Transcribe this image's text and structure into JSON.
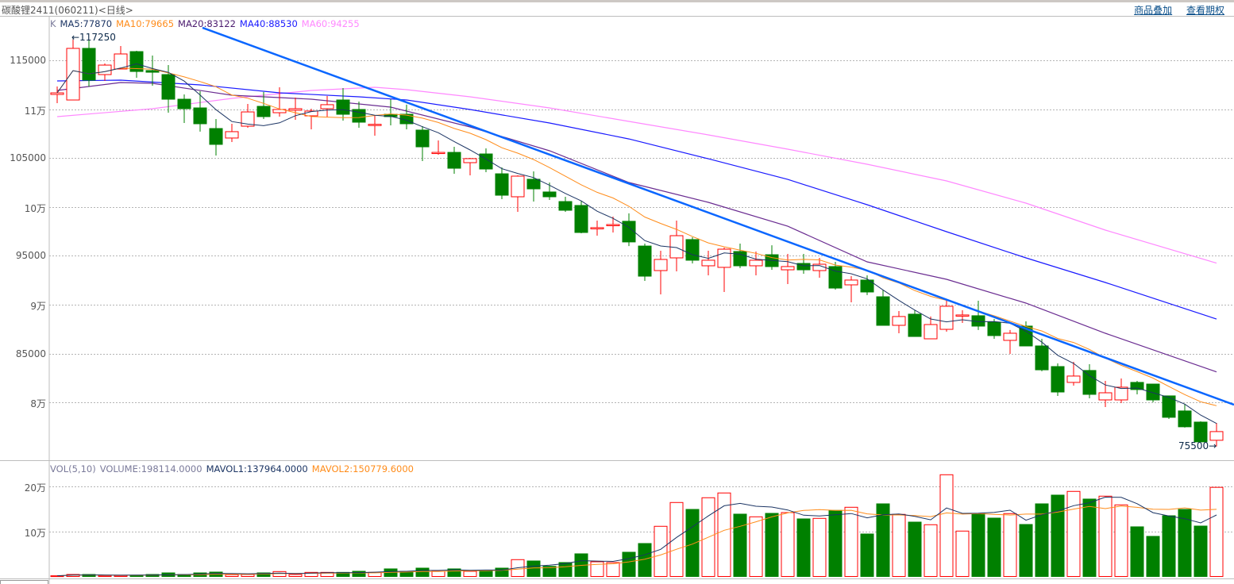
{
  "header": {
    "title": "碳酸锂2411(060211)<日线>",
    "links": [
      "商品叠加",
      "查看期权"
    ]
  },
  "legend": {
    "k": "K",
    "ma5": "MA5:77870",
    "ma10": "MA10:79665",
    "ma20": "MA20:83122",
    "ma40": "MA40:88530",
    "ma60": "MA60:94255"
  },
  "vol_legend": {
    "vol": "VOL(5,10)",
    "volume": "VOLUME:198114.0000",
    "mavol1": "MAVOL1:137964.0000",
    "mavol2": "MAVOL2:150779.6000"
  },
  "colors": {
    "up": "#ff0000",
    "down": "#008000",
    "ma5": "#1c3564",
    "ma10": "#ff8c1a",
    "ma20": "#6a2c91",
    "ma40": "#1a1aff",
    "ma60": "#ff88ff",
    "trend": "#0a66ff",
    "grid": "#b4b4b4"
  },
  "annotations": {
    "high": "←117250",
    "low": "75500→"
  },
  "chart_data": [
    {
      "type": "candlestick",
      "title": "碳酸锂2411 日线",
      "price_ticks": [
        {
          "value": 115000,
          "label": "115000"
        },
        {
          "value": 110000,
          "label": "11万"
        },
        {
          "value": 105000,
          "label": "105000"
        },
        {
          "value": 100000,
          "label": "10万"
        },
        {
          "value": 95000,
          "label": "95000"
        },
        {
          "value": 90000,
          "label": "9万"
        },
        {
          "value": 85000,
          "label": "85000"
        },
        {
          "value": 80000,
          "label": "8万"
        }
      ],
      "high_marker": {
        "index": 1,
        "value": 117250
      },
      "low_marker": {
        "index": 73,
        "value": 75500
      },
      "ohlc": [
        [
          111510,
          112320,
          110620,
          111670
        ],
        [
          110940,
          117250,
          110940,
          116220
        ],
        [
          116220,
          117100,
          112320,
          112970
        ],
        [
          113540,
          114680,
          112890,
          114510
        ],
        [
          114110,
          116460,
          114110,
          115650
        ],
        [
          115890,
          115970,
          113210,
          113860
        ],
        [
          113950,
          115490,
          112400,
          113780
        ],
        [
          113540,
          114510,
          109640,
          111020
        ],
        [
          111020,
          111510,
          108590,
          110050
        ],
        [
          110130,
          111840,
          107700,
          108510
        ],
        [
          108020,
          108990,
          105260,
          106400
        ],
        [
          107050,
          108510,
          106640,
          107700
        ],
        [
          108260,
          110540,
          108100,
          109720
        ],
        [
          110290,
          111760,
          108990,
          109240
        ],
        [
          109640,
          112240,
          109240,
          109970
        ],
        [
          109890,
          111190,
          108910,
          110050
        ],
        [
          109320,
          110050,
          107940,
          109810
        ],
        [
          110050,
          111350,
          109160,
          110460
        ],
        [
          110940,
          112160,
          108830,
          109480
        ],
        [
          109970,
          110780,
          108100,
          108670
        ],
        [
          108400,
          109320,
          107290,
          108450
        ],
        [
          109480,
          111020,
          108340,
          109240
        ],
        [
          109480,
          110460,
          107940,
          108510
        ],
        [
          107860,
          108260,
          104690,
          106150
        ],
        [
          105540,
          106800,
          105340,
          105580
        ],
        [
          105580,
          106150,
          103390,
          103960
        ],
        [
          104530,
          105020,
          103230,
          104940
        ],
        [
          105420,
          105990,
          103560,
          103880
        ],
        [
          103390,
          104040,
          100800,
          101200
        ],
        [
          101040,
          103230,
          99500,
          103150
        ],
        [
          102830,
          103640,
          100550,
          101850
        ],
        [
          101530,
          102500,
          100710,
          101040
        ],
        [
          100550,
          101040,
          99500,
          99660
        ],
        [
          100150,
          100630,
          97310,
          97390
        ],
        [
          97850,
          98600,
          97060,
          97880
        ],
        [
          98150,
          99010,
          97390,
          98200
        ],
        [
          98530,
          99340,
          96000,
          96420
        ],
        [
          96000,
          96250,
          92440,
          92920
        ],
        [
          93490,
          95520,
          91060,
          94630
        ],
        [
          94790,
          98600,
          93410,
          97060
        ],
        [
          96660,
          96900,
          94220,
          94550
        ],
        [
          93980,
          95520,
          93000,
          94550
        ],
        [
          93820,
          95840,
          91300,
          95680
        ],
        [
          95440,
          96250,
          93740,
          93980
        ],
        [
          93980,
          95440,
          93000,
          94550
        ],
        [
          95110,
          96080,
          93570,
          93900
        ],
        [
          93570,
          95190,
          92110,
          93900
        ],
        [
          94220,
          95190,
          93170,
          93570
        ],
        [
          93490,
          94790,
          92760,
          94140
        ],
        [
          93900,
          94380,
          91540,
          91700
        ],
        [
          92030,
          92920,
          90240,
          92520
        ],
        [
          92520,
          93000,
          90980,
          91300
        ],
        [
          90810,
          91540,
          87890,
          87890
        ],
        [
          87890,
          89350,
          87080,
          88790
        ],
        [
          89030,
          89430,
          86750,
          86750
        ],
        [
          86510,
          88790,
          86510,
          87970
        ],
        [
          87480,
          90490,
          87240,
          89840
        ],
        [
          88900,
          89430,
          88130,
          88950
        ],
        [
          88870,
          90410,
          87410,
          87810
        ],
        [
          88220,
          88540,
          86510,
          86840
        ],
        [
          86350,
          87410,
          84970,
          87080
        ],
        [
          87810,
          88300,
          85780,
          85780
        ],
        [
          85780,
          86510,
          83190,
          83340
        ],
        [
          83670,
          83990,
          80670,
          81070
        ],
        [
          82050,
          84160,
          81720,
          82700
        ],
        [
          83270,
          83910,
          80420,
          80830
        ],
        [
          80260,
          82210,
          79530,
          80990
        ],
        [
          80260,
          82450,
          79940,
          81560
        ],
        [
          82050,
          82210,
          80830,
          81320
        ],
        [
          81880,
          81880,
          80020,
          80260
        ],
        [
          80670,
          80670,
          78310,
          78480
        ],
        [
          79130,
          79860,
          77430,
          77510
        ],
        [
          77990,
          78070,
          75970,
          75970
        ],
        [
          76130,
          77910,
          75500,
          77020
        ]
      ],
      "moving_averages_knots": {
        "ma20": [
          [
            0,
            111915
          ],
          [
            4,
            112727
          ],
          [
            6,
            112650
          ],
          [
            11,
            111430
          ],
          [
            16,
            111023
          ],
          [
            21,
            110210
          ],
          [
            26,
            108180
          ],
          [
            31,
            105750
          ],
          [
            36,
            102500
          ],
          [
            41,
            100470
          ],
          [
            46,
            98030
          ],
          [
            51,
            94380
          ],
          [
            56,
            92600
          ],
          [
            61,
            90160
          ],
          [
            66,
            87080
          ],
          [
            73,
            83122
          ]
        ],
        "ma40": [
          [
            0,
            112890
          ],
          [
            4,
            112970
          ],
          [
            9,
            112480
          ],
          [
            14,
            111670
          ],
          [
            19,
            111270
          ],
          [
            22,
            110940
          ],
          [
            26,
            109970
          ],
          [
            31,
            108590
          ],
          [
            36,
            106960
          ],
          [
            41,
            104930
          ],
          [
            46,
            102820
          ],
          [
            51,
            100230
          ],
          [
            56,
            97470
          ],
          [
            61,
            94790
          ],
          [
            66,
            92270
          ],
          [
            73,
            88530
          ]
        ],
        "ma60": [
          [
            0,
            109236
          ],
          [
            6,
            110049
          ],
          [
            11,
            111104
          ],
          [
            16,
            111916
          ],
          [
            20,
            112240
          ],
          [
            22,
            111996
          ],
          [
            26,
            111265
          ],
          [
            31,
            110130
          ],
          [
            36,
            108750
          ],
          [
            41,
            107370
          ],
          [
            46,
            105910
          ],
          [
            51,
            104367
          ],
          [
            56,
            102664
          ],
          [
            61,
            100390
          ],
          [
            66,
            97630
          ],
          [
            73,
            94255
          ]
        ]
      },
      "trendline": {
        "from": [
          9.15,
          118330
        ],
        "to": [
          74.1,
          79770
        ]
      },
      "ylim": [
        74000,
        120000
      ]
    },
    {
      "type": "bar",
      "title": "VOL(5,10)",
      "volume_ticks": [
        {
          "value": 200000,
          "label": "20万"
        },
        {
          "value": 100000,
          "label": "10万"
        }
      ],
      "volume": [
        1500,
        4400,
        4400,
        2100,
        2100,
        2100,
        4400,
        7900,
        4400,
        7900,
        9700,
        3900,
        4400,
        7900,
        10900,
        4400,
        9100,
        9100,
        9100,
        11500,
        9100,
        16800,
        10900,
        18500,
        11500,
        16800,
        11500,
        12700,
        18500,
        37400,
        34400,
        22600,
        30900,
        50300,
        32600,
        30900,
        53800,
        73200,
        111500,
        164400,
        149000,
        175000,
        185600,
        138500,
        132600,
        140200,
        142000,
        127900,
        129100,
        146800,
        153800,
        94400,
        161400,
        138000,
        120800,
        115000,
        226100,
        100900,
        139700,
        129700,
        139700,
        115500,
        161400,
        180800,
        189100,
        172000,
        178500,
        159100,
        110300,
        89100,
        134900,
        149000,
        112000,
        198114
      ]
    }
  ]
}
